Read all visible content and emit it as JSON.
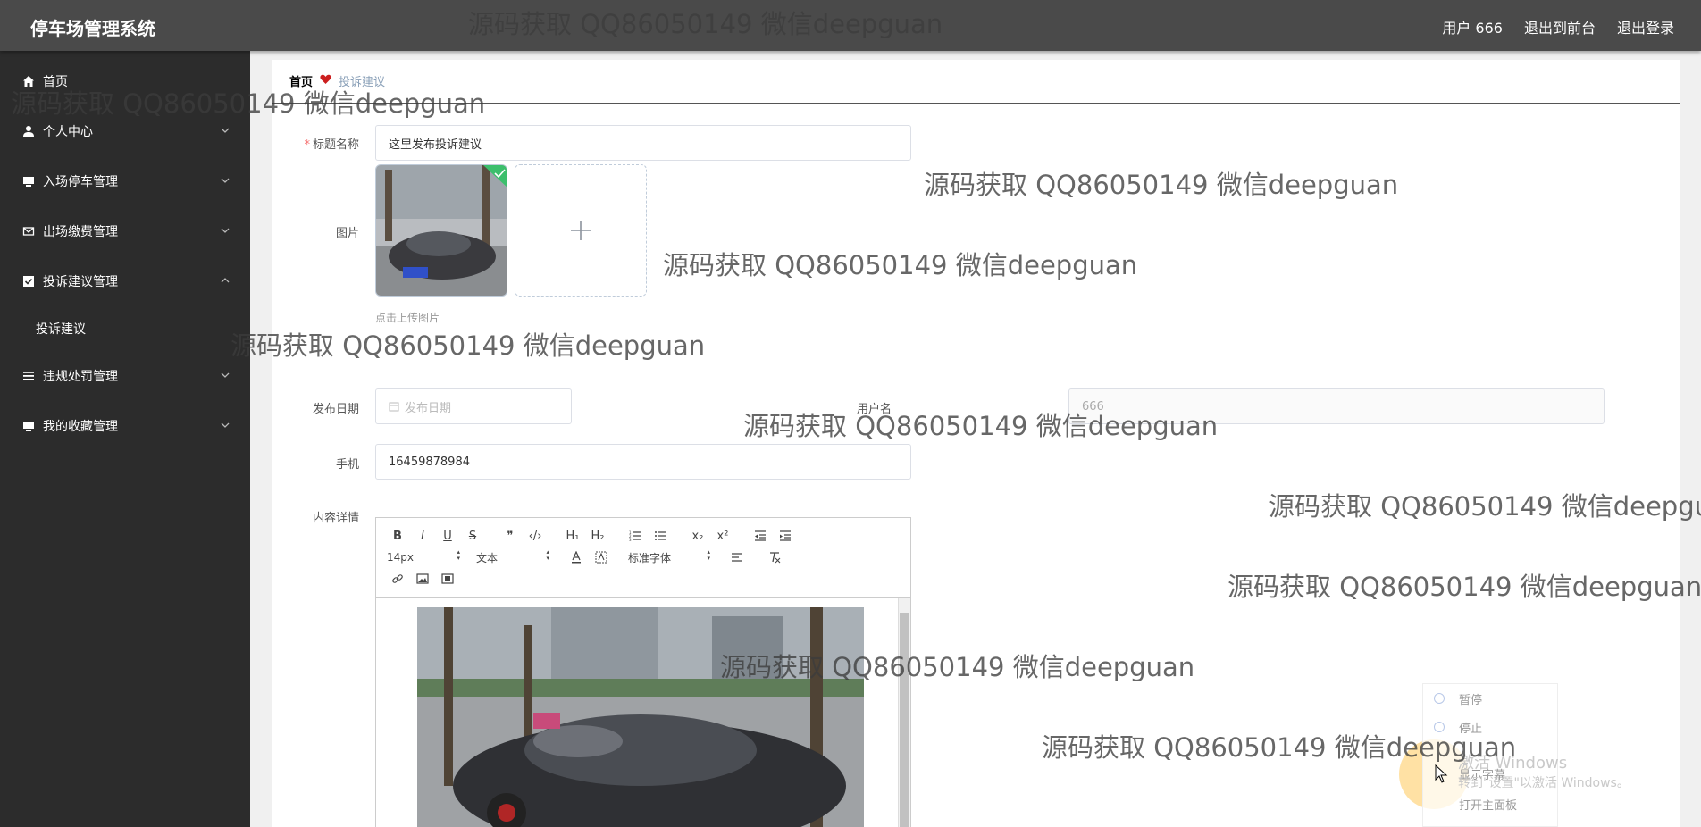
{
  "app": {
    "title": "停车场管理系统"
  },
  "header": {
    "user_label": "用户 666",
    "front_label": "退出到前台",
    "logout_label": "退出登录"
  },
  "sidebar": {
    "items": [
      {
        "label": "首页",
        "icon": "home-icon"
      },
      {
        "label": "个人中心",
        "icon": "user-icon"
      },
      {
        "label": "入场停车管理",
        "icon": "monitor-icon"
      },
      {
        "label": "出场缴费管理",
        "icon": "mail-icon"
      },
      {
        "label": "投诉建议管理",
        "icon": "checkbox-icon",
        "expanded": true,
        "children": [
          {
            "label": "投诉建议"
          }
        ]
      },
      {
        "label": "违规处罚管理",
        "icon": "list-icon"
      },
      {
        "label": "我的收藏管理",
        "icon": "monitor-icon"
      }
    ]
  },
  "breadcrumb": {
    "home": "首页",
    "current": "投诉建议"
  },
  "form": {
    "title_label": "标题名称",
    "title_value": "这里发布投诉建议",
    "image_label": "图片",
    "upload_tip": "点击上传图片",
    "date_label": "发布日期",
    "date_placeholder": "发布日期",
    "username_label": "用户名",
    "username_value": "666",
    "phone_label": "手机",
    "phone_value": "16459878984",
    "content_label": "内容详情"
  },
  "editor": {
    "font_size": "14px",
    "paragraph": "文本",
    "font_family": "标准字体",
    "buttons": [
      "B",
      "I",
      "U",
      "S",
      "❞",
      "‹/›",
      "H₁",
      "H₂",
      "x₂",
      "x²"
    ]
  },
  "overlay": {
    "watermark": "源码获取 QQ86050149 微信deepguan",
    "media_menu": [
      "暂停",
      "停止",
      "显示字幕",
      "打开主面板"
    ],
    "activate_title": "激活 Windows",
    "activate_sub": "转到\"设置\"以激活 Windows。"
  },
  "colors": {
    "header_bg": "#4a4a4a",
    "sidebar_bg": "#2c2c2c",
    "accent_heart": "#cc1f1f",
    "required": "#f56c6c"
  }
}
